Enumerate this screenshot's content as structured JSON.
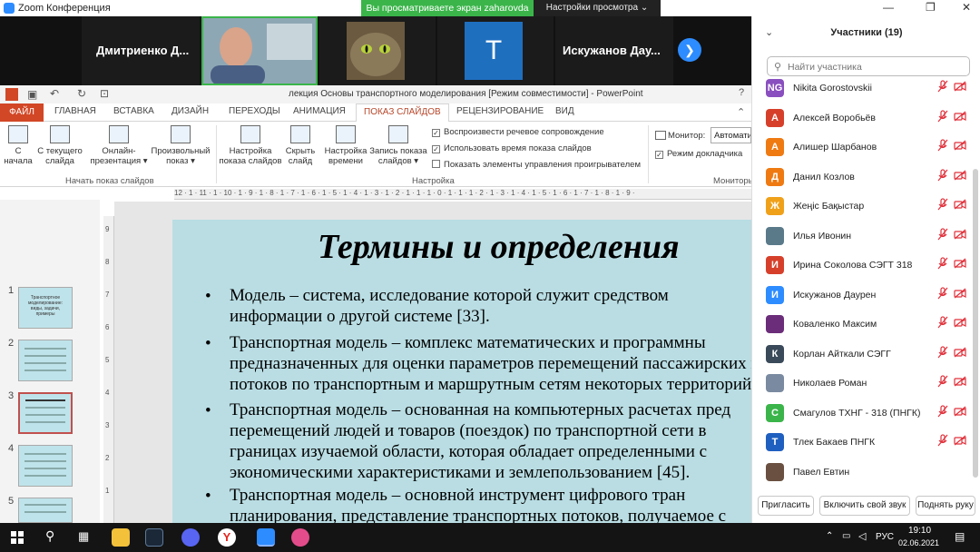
{
  "zoom": {
    "window_title": "Zoom Конференция",
    "share_banner": "Вы просматриваете экран zaharovda",
    "view_settings": "Настройки просмотра ⌄"
  },
  "video_strip": {
    "tiles": [
      {
        "name": "Дмитриенко Д..."
      },
      {
        "name": ""
      },
      {
        "name": ""
      },
      {
        "initial": "T"
      },
      {
        "name": "Искужанов Дау..."
      }
    ]
  },
  "powerpoint": {
    "doc_title": "лекция Основы транспортного моделирования [Режим совместимости] - PowerPoint",
    "tabs": [
      "ФАЙЛ",
      "ГЛАВНАЯ",
      "ВСТАВКА",
      "ДИЗАЙН",
      "ПЕРЕХОДЫ",
      "АНИМАЦИЯ",
      "ПОКАЗ СЛАЙДОВ",
      "РЕЦЕНЗИРОВАНИЕ",
      "ВИД"
    ],
    "active_tab": "ПОКАЗ СЛАЙДОВ",
    "ribbon": {
      "btn_from_start": [
        "С",
        "начала"
      ],
      "btn_from_current": [
        "С текущего",
        "слайда"
      ],
      "btn_online": [
        "Онлайн-",
        "презентация ▾"
      ],
      "btn_custom": [
        "Произвольный",
        "показ ▾"
      ],
      "group_start": "Начать показ слайдов",
      "btn_setup": [
        "Настройка",
        "показа слайдов"
      ],
      "btn_hide": [
        "Скрыть",
        "слайд"
      ],
      "btn_timings": [
        "Настройка",
        "времени"
      ],
      "btn_record": [
        "Запись показа",
        "слайдов ▾"
      ],
      "chk_narration": "Воспроизвести речевое сопровождение",
      "chk_timings": "Использовать время показа слайдов",
      "chk_media": "Показать элементы управления проигрывателем",
      "group_setup": "Настройка",
      "monitor_label": "Монитор:",
      "monitor_value": "Автомати",
      "presenter_view": "Режим докладчика",
      "group_monitors": "Мониторы"
    },
    "ruler_h": "12 · 1 · 11 · 1 · 10 · 1 · 9 · 1 · 8 · 1 · 7 · 1 · 6 · 1 · 5 · 1 · 4 · 1 · 3 · 1 · 2 · 1 · 1 · 1 · 0 · 1 · 1 · 1 · 2 · 1 · 3 · 1 · 4 · 1 · 5 · 1 · 6 · 1 · 7 · 1 · 8 · 1 · 9 ·",
    "ruler_v": [
      "9",
      "8",
      "7",
      "6",
      "5",
      "4",
      "3",
      "2",
      "1"
    ],
    "thumb_numbers": [
      "1",
      "2",
      "3",
      "4",
      "5",
      "6"
    ],
    "thumb1_text": "Транспортное моделирование: виды, задачи, примеры",
    "slide": {
      "title": "Термины и определения",
      "bullets": [
        [
          "Модель – система, исследование которой служит средством",
          "информации о другой системе [33]."
        ],
        [
          "Транспортная модель – комплекс математических и программны",
          "предназначенных для оценки параметров перемещений пассажирских и",
          "потоков по транспортным и маршрутным сетям некоторых территорий"
        ],
        [
          "Транспортная модель – основанная на компьютерных расчетах пред",
          "перемещений людей и товаров (поездок) по транспортной сети в",
          "границах изучаемой области, которая обладает определенными с",
          "экономическими характеристиками и землепользованием [45]."
        ],
        [
          "Транспортная модель – основной инструмент цифрового тран",
          "планирования, представление транспортных потоков, получаемое с"
        ]
      ]
    }
  },
  "participants": {
    "title": "Участники (19)",
    "search_placeholder": "Найти участника",
    "list": [
      {
        "initials": "NG",
        "name": "Nikita Gorostovskii",
        "color": "#8a4fbf"
      },
      {
        "initials": "А",
        "name": "Алексей Воробьёв",
        "color": "#d6402b"
      },
      {
        "initials": "А",
        "name": "Алишер Шарбанов",
        "color": "#ef7a12"
      },
      {
        "initials": "Д",
        "name": "Данил Козлов",
        "color": "#ef7a12"
      },
      {
        "initials": "Ж",
        "name": "Жеңіс Бақыстар",
        "color": "#f0a11a"
      },
      {
        "initials": "",
        "name": "Илья Ивонин",
        "color": "#5a7a8a"
      },
      {
        "initials": "И",
        "name": "Ирина Соколова СЭГТ 318",
        "color": "#d6402b"
      },
      {
        "initials": "И",
        "name": "Искужанов Даурен",
        "color": "#2d8cff"
      },
      {
        "initials": "",
        "name": "Коваленко Максим",
        "color": "#6b2d7a"
      },
      {
        "initials": "К",
        "name": "Корлан Айткали СЭГГ",
        "color": "#3a4a5a"
      },
      {
        "initials": "",
        "name": "Николаев Роман",
        "color": "#7a8aa0"
      },
      {
        "initials": "С",
        "name": "Смагулов ТХНГ - 318 (ПНГК)",
        "color": "#3bb54a"
      },
      {
        "initials": "Т",
        "name": "Тлек Бакаев ПНГК",
        "color": "#1f5fbf"
      },
      {
        "initials": "",
        "name": "Павел Евтин",
        "color": "#6a5040"
      }
    ],
    "btn_invite": "Пригласить",
    "btn_unmute": "Включить свой звук",
    "btn_raise": "Поднять руку"
  },
  "taskbar": {
    "lang": "РУС",
    "time": "19:10",
    "date": "02.06.2021"
  }
}
